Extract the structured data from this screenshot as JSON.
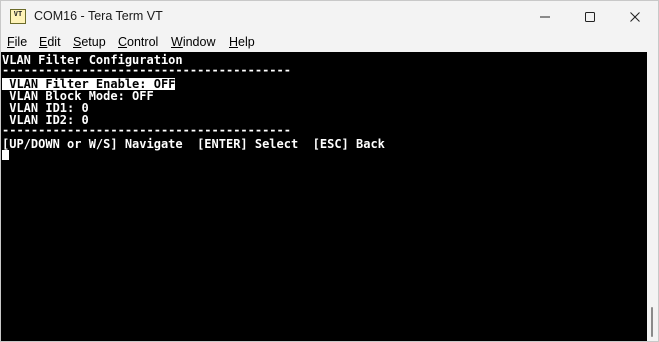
{
  "window": {
    "title": "COM16 - Tera Term VT",
    "icon_label": "VT",
    "icons": {
      "app": "tera-term-icon",
      "minimize": "minimize-icon",
      "maximize": "maximize-icon",
      "close": "close-icon"
    }
  },
  "menu": {
    "items": [
      {
        "key": "F",
        "rest": "ile"
      },
      {
        "key": "E",
        "rest": "dit"
      },
      {
        "key": "S",
        "rest": "etup"
      },
      {
        "key": "C",
        "rest": "ontrol"
      },
      {
        "key": "W",
        "rest": "indow"
      },
      {
        "key": "H",
        "rest": "elp"
      }
    ]
  },
  "terminal": {
    "heading": "VLAN Filter Configuration",
    "divider_top": "----------------------------------------",
    "options": [
      " VLAN Filter Enable: OFF",
      " VLAN Block Mode: OFF",
      " VLAN ID1: 0",
      " VLAN ID2: 0"
    ],
    "selected_option": 0,
    "divider_bottom": "----------------------------------------",
    "help": "[UP/DOWN or W/S] Navigate  [ENTER] Select  [ESC] Back"
  },
  "colors": {
    "terminal_bg": "#000000",
    "terminal_fg": "#ffffff",
    "chrome_bg": "#f3f3f3"
  }
}
